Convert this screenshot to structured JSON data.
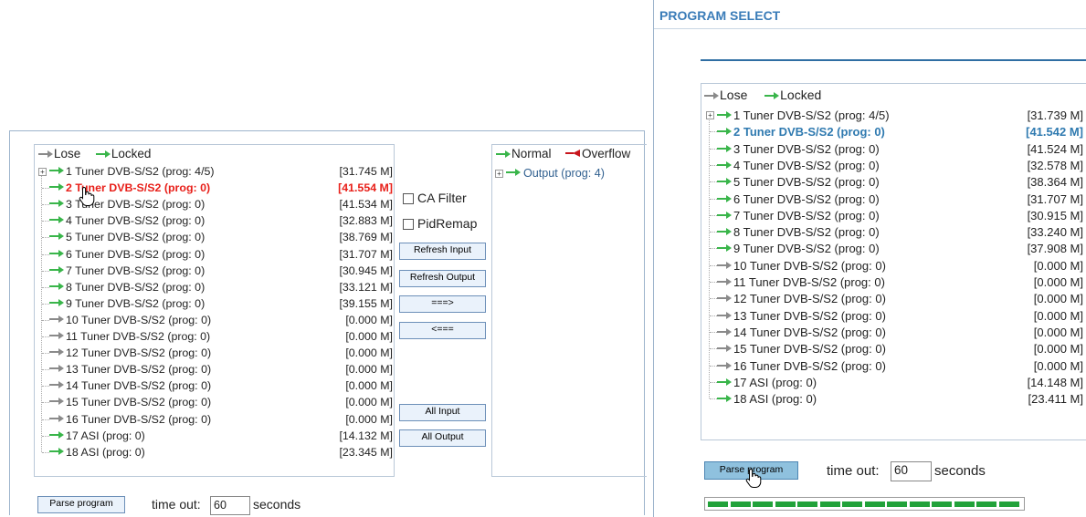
{
  "colors": {
    "accent_blue": "#3a7cb8",
    "selected_red": "#e8201a",
    "selected_blue": "#2f7ab0",
    "locked_green": "#39b54a",
    "lose_gray": "#8a8a8a",
    "overflow_red": "#c8161d"
  },
  "left": {
    "legend": {
      "lose": "Lose",
      "locked": "Locked"
    },
    "items": [
      {
        "label": "1 Tuner DVB-S/S2 (prog: 4/5)",
        "value": "[31.745 M]",
        "state": "locked",
        "expandable": true
      },
      {
        "label": "2 Tuner DVB-S/S2 (prog: 0)",
        "value": "[41.554 M]",
        "state": "selected"
      },
      {
        "label": "3 Tuner DVB-S/S2 (prog: 0)",
        "value": "[41.534 M]",
        "state": "locked"
      },
      {
        "label": "4 Tuner DVB-S/S2 (prog: 0)",
        "value": "[32.883 M]",
        "state": "locked"
      },
      {
        "label": "5 Tuner DVB-S/S2 (prog: 0)",
        "value": "[38.769 M]",
        "state": "locked"
      },
      {
        "label": "6 Tuner DVB-S/S2 (prog: 0)",
        "value": "[31.707 M]",
        "state": "locked"
      },
      {
        "label": "7 Tuner DVB-S/S2 (prog: 0)",
        "value": "[30.945 M]",
        "state": "locked"
      },
      {
        "label": "8 Tuner DVB-S/S2 (prog: 0)",
        "value": "[33.121 M]",
        "state": "locked"
      },
      {
        "label": "9 Tuner DVB-S/S2 (prog: 0)",
        "value": "[39.155 M]",
        "state": "locked"
      },
      {
        "label": "10 Tuner DVB-S/S2 (prog: 0)",
        "value": "[0.000 M]",
        "state": "lose"
      },
      {
        "label": "11 Tuner DVB-S/S2 (prog: 0)",
        "value": "[0.000 M]",
        "state": "lose"
      },
      {
        "label": "12 Tuner DVB-S/S2 (prog: 0)",
        "value": "[0.000 M]",
        "state": "lose"
      },
      {
        "label": "13 Tuner DVB-S/S2 (prog: 0)",
        "value": "[0.000 M]",
        "state": "lose"
      },
      {
        "label": "14 Tuner DVB-S/S2 (prog: 0)",
        "value": "[0.000 M]",
        "state": "lose"
      },
      {
        "label": "15 Tuner DVB-S/S2 (prog: 0)",
        "value": "[0.000 M]",
        "state": "lose"
      },
      {
        "label": "16 Tuner DVB-S/S2 (prog: 0)",
        "value": "[0.000 M]",
        "state": "lose"
      },
      {
        "label": "17 ASI (prog: 0)",
        "value": "[14.132 M]",
        "state": "locked"
      },
      {
        "label": "18 ASI (prog: 0)",
        "value": "[23.345 M]",
        "state": "locked"
      }
    ],
    "ca_filter_label": "CA Filter",
    "pid_remap_label": "PidRemap",
    "buttons": {
      "refresh_input": "Refresh Input",
      "refresh_output": "Refresh Output",
      "to_output": "===>",
      "to_input": "<===",
      "all_input": "All Input",
      "all_output": "All Output"
    },
    "output_legend": {
      "normal": "Normal",
      "overflow": "Overflow"
    },
    "output_item": "Output (prog: 4)",
    "parse_button": "Parse program",
    "timeout_label": "time out:",
    "timeout_value": "60",
    "seconds_label": "seconds"
  },
  "right": {
    "title": "PROGRAM SELECT",
    "legend": {
      "lose": "Lose",
      "locked": "Locked"
    },
    "items": [
      {
        "label": "1 Tuner DVB-S/S2 (prog: 4/5)",
        "value": "[31.739 M]",
        "state": "locked",
        "expandable": true
      },
      {
        "label": "2 Tuner DVB-S/S2 (prog: 0)",
        "value": "[41.542 M]",
        "state": "selected"
      },
      {
        "label": "3 Tuner DVB-S/S2 (prog: 0)",
        "value": "[41.524 M]",
        "state": "locked"
      },
      {
        "label": "4 Tuner DVB-S/S2 (prog: 0)",
        "value": "[32.578 M]",
        "state": "locked"
      },
      {
        "label": "5 Tuner DVB-S/S2 (prog: 0)",
        "value": "[38.364 M]",
        "state": "locked"
      },
      {
        "label": "6 Tuner DVB-S/S2 (prog: 0)",
        "value": "[31.707 M]",
        "state": "locked"
      },
      {
        "label": "7 Tuner DVB-S/S2 (prog: 0)",
        "value": "[30.915 M]",
        "state": "locked"
      },
      {
        "label": "8 Tuner DVB-S/S2 (prog: 0)",
        "value": "[33.240 M]",
        "state": "locked"
      },
      {
        "label": "9 Tuner DVB-S/S2 (prog: 0)",
        "value": "[37.908 M]",
        "state": "locked"
      },
      {
        "label": "10 Tuner DVB-S/S2 (prog: 0)",
        "value": "[0.000 M]",
        "state": "lose"
      },
      {
        "label": "11 Tuner DVB-S/S2 (prog: 0)",
        "value": "[0.000 M]",
        "state": "lose"
      },
      {
        "label": "12 Tuner DVB-S/S2 (prog: 0)",
        "value": "[0.000 M]",
        "state": "lose"
      },
      {
        "label": "13 Tuner DVB-S/S2 (prog: 0)",
        "value": "[0.000 M]",
        "state": "lose"
      },
      {
        "label": "14 Tuner DVB-S/S2 (prog: 0)",
        "value": "[0.000 M]",
        "state": "lose"
      },
      {
        "label": "15 Tuner DVB-S/S2 (prog: 0)",
        "value": "[0.000 M]",
        "state": "lose"
      },
      {
        "label": "16 Tuner DVB-S/S2 (prog: 0)",
        "value": "[0.000 M]",
        "state": "lose"
      },
      {
        "label": "17 ASI (prog: 0)",
        "value": "[14.148 M]",
        "state": "locked"
      },
      {
        "label": "18 ASI (prog: 0)",
        "value": "[23.411 M]",
        "state": "locked"
      }
    ],
    "parse_button": "Parse program",
    "timeout_label": "time out:",
    "timeout_value": "60",
    "seconds_label": "seconds",
    "progress_segments": 14
  }
}
